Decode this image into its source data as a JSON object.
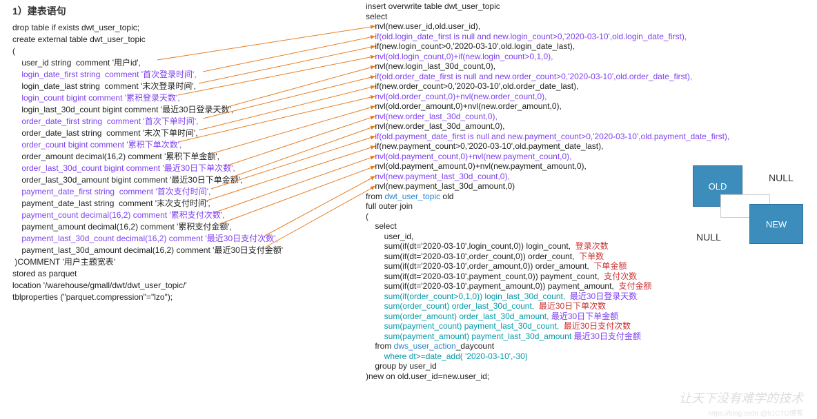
{
  "title": "1）建表语句",
  "left_lines": [
    {
      "t": "drop table if exists dwt_user_topic;",
      "c": "black",
      "i": 0
    },
    {
      "t": "create external table dwt_user_topic",
      "c": "black",
      "i": 0
    },
    {
      "t": "(",
      "c": "black",
      "i": 0
    },
    {
      "t": "user_id string  comment '用户id',",
      "c": "black",
      "i": 1
    },
    {
      "t": "login_date_first string  comment '首次登录时间',",
      "c": "purple",
      "i": 1
    },
    {
      "t": "login_date_last string  comment '末次登录时间',",
      "c": "black",
      "i": 1
    },
    {
      "t": "login_count bigint comment '累积登录天数',",
      "c": "purple",
      "i": 1
    },
    {
      "t": "login_last_30d_count bigint comment '最近30日登录天数',",
      "c": "black",
      "i": 1
    },
    {
      "t": "order_date_first string  comment '首次下单时间',",
      "c": "purple",
      "i": 1
    },
    {
      "t": "order_date_last string  comment '末次下单时间',",
      "c": "black",
      "i": 1
    },
    {
      "t": "order_count bigint comment '累积下单次数',",
      "c": "purple",
      "i": 1
    },
    {
      "t": "order_amount decimal(16,2) comment '累积下单金额',",
      "c": "black",
      "i": 1
    },
    {
      "t": "order_last_30d_count bigint comment '最近30日下单次数',",
      "c": "purple",
      "i": 1
    },
    {
      "t": "order_last_30d_amount bigint comment '最近30日下单金额',",
      "c": "black",
      "i": 1
    },
    {
      "t": "payment_date_first string  comment '首次支付时间',",
      "c": "purple",
      "i": 1
    },
    {
      "t": "payment_date_last string  comment '末次支付时间',",
      "c": "black",
      "i": 1
    },
    {
      "t": "payment_count decimal(16,2) comment '累积支付次数',",
      "c": "purple",
      "i": 1
    },
    {
      "t": "payment_amount decimal(16,2) comment '累积支付金额',",
      "c": "black",
      "i": 1
    },
    {
      "t": "payment_last_30d_count decimal(16,2) comment '最近30日支付次数',",
      "c": "purple",
      "i": 1
    },
    {
      "t": "payment_last_30d_amount decimal(16,2) comment '最近30日支付金额'",
      "c": "black",
      "i": 1
    },
    {
      "t": " )COMMENT '用户主题宽表'",
      "c": "black",
      "i": 0
    },
    {
      "t": "stored as parquet",
      "c": "black",
      "i": 0
    },
    {
      "t": "location '/warehouse/gmall/dwt/dwt_user_topic/'",
      "c": "black",
      "i": 0
    },
    {
      "t": "tblproperties (\"parquet.compression\"=\"lzo\");",
      "c": "black",
      "i": 0
    }
  ],
  "right_lines": [
    {
      "t": "insert overwrite table dwt_user_topic",
      "c": "black",
      "i": 0
    },
    {
      "t": "select",
      "c": "black",
      "i": 0
    },
    {
      "t": "nvl(new.user_id,old.user_id),",
      "c": "black",
      "i": 1,
      "arrow": true
    },
    {
      "t": "if(old.login_date_first is null and new.login_count>0,'2020-03-10',old.login_date_first),",
      "c": "purple",
      "i": 1,
      "arrow": true
    },
    {
      "t": "if(new.login_count>0,'2020-03-10',old.login_date_last),",
      "c": "black",
      "i": 1,
      "arrow": true
    },
    {
      "t": "nvl(old.login_count,0)+if(new.login_count>0,1,0),",
      "c": "purple",
      "i": 1,
      "arrow": true
    },
    {
      "t": "nvl(new.login_last_30d_count,0),",
      "c": "black",
      "i": 1,
      "arrow": true
    },
    {
      "t": "if(old.order_date_first is null and new.order_count>0,'2020-03-10',old.order_date_first),",
      "c": "purple",
      "i": 1,
      "arrow": true
    },
    {
      "t": "if(new.order_count>0,'2020-03-10',old.order_date_last),",
      "c": "black",
      "i": 1,
      "arrow": true
    },
    {
      "t": "nvl(old.order_count,0)+nvl(new.order_count,0),",
      "c": "purple",
      "i": 1,
      "arrow": true
    },
    {
      "t": "nvl(old.order_amount,0)+nvl(new.order_amount,0),",
      "c": "black",
      "i": 1,
      "arrow": true
    },
    {
      "t": "nvl(new.order_last_30d_count,0),",
      "c": "purple",
      "i": 1,
      "arrow": true
    },
    {
      "t": "nvl(new.order_last_30d_amount,0),",
      "c": "black",
      "i": 1,
      "arrow": true
    },
    {
      "t": "if(old.payment_date_first is null and new.payment_count>0,'2020-03-10',old.payment_date_first),",
      "c": "purple",
      "i": 1,
      "arrow": true
    },
    {
      "t": "if(new.payment_count>0,'2020-03-10',old.payment_date_last),",
      "c": "black",
      "i": 1,
      "arrow": true
    },
    {
      "t": "nvl(old.payment_count,0)+nvl(new.payment_count,0),",
      "c": "purple",
      "i": 1,
      "arrow": true
    },
    {
      "t": "nvl(old.payment_amount,0)+nvl(new.payment_amount,0),",
      "c": "black",
      "i": 1,
      "arrow": true
    },
    {
      "t": "nvl(new.payment_last_30d_count,0),",
      "c": "purple",
      "i": 1,
      "arrow": true
    },
    {
      "t": "nvl(new.payment_last_30d_amount,0)",
      "c": "black",
      "i": 1,
      "arrow": true
    },
    {
      "t": "from <span class='blue'>dwt_user_topic</span> old",
      "c": "black",
      "i": 0
    },
    {
      "t": "full outer join",
      "c": "black",
      "i": 0
    },
    {
      "t": "(",
      "c": "black",
      "i": 0
    },
    {
      "t": "select",
      "c": "black",
      "i": 1
    },
    {
      "t": "user_id,",
      "c": "black",
      "i": 2
    },
    {
      "t": "sum(if(dt='2020-03-10',login_count,0)) login_count,  <span class='red-ann'>登录次数</span>",
      "c": "black",
      "i": 2
    },
    {
      "t": "sum(if(dt='2020-03-10',order_count,0)) order_count,  <span class='red-ann'>下单数</span>",
      "c": "black",
      "i": 2
    },
    {
      "t": "sum(if(dt='2020-03-10',order_amount,0)) order_amount,  <span class='red-ann'>下单金额</span>",
      "c": "black",
      "i": 2
    },
    {
      "t": "sum(if(dt='2020-03-10',payment_count,0)) payment_count,  <span class='red-ann'>支付次数</span>",
      "c": "black",
      "i": 2
    },
    {
      "t": "sum(if(dt='2020-03-10',payment_amount,0)) payment_amount,  <span class='red-ann'>支付金额</span>",
      "c": "black",
      "i": 2
    },
    {
      "t": "<span class='teal'>sum(if(order_count>0,1,0)) login_last_30d_count,</span>  <span class='purple-ann'>最近30日登录天数</span>",
      "c": "black",
      "i": 2
    },
    {
      "t": "<span class='teal'>sum(order_count) order_last_30d_count,</span>  <span class='red-ann'>最近30日下单次数</span>",
      "c": "black",
      "i": 2
    },
    {
      "t": "<span class='teal'>sum(order_amount) order_last_30d_amount,</span> <span class='purple-ann'>最近30日下单金额</span>",
      "c": "black",
      "i": 2
    },
    {
      "t": "<span class='teal'>sum(payment_count) payment_last_30d_count,</span>  <span class='red-ann'>最近30日支付次数</span>",
      "c": "black",
      "i": 2
    },
    {
      "t": "<span class='teal'>sum(payment_amount) payment_last_30d_amount</span> <span class='purple-ann'>最近30日支付金额</span>",
      "c": "black",
      "i": 2
    },
    {
      "t": "from <span class='blue'>dws_user_action</span>_daycount",
      "c": "black",
      "i": 1
    },
    {
      "t": "<span class='teal'>where dt&gt;=date_add( '2020-03-10',-30)</span>",
      "c": "black",
      "i": 2
    },
    {
      "t": "group by user_id",
      "c": "black",
      "i": 1
    },
    {
      "t": ")new on old.user_id=new.user_id;",
      "c": "black",
      "i": 0
    }
  ],
  "diagram": {
    "old": "OLD",
    "new": "NEW",
    "null": "NULL"
  },
  "watermark": "让天下没有难学的技术",
  "wm2": "https://blog.csdn  @51CTO博客"
}
